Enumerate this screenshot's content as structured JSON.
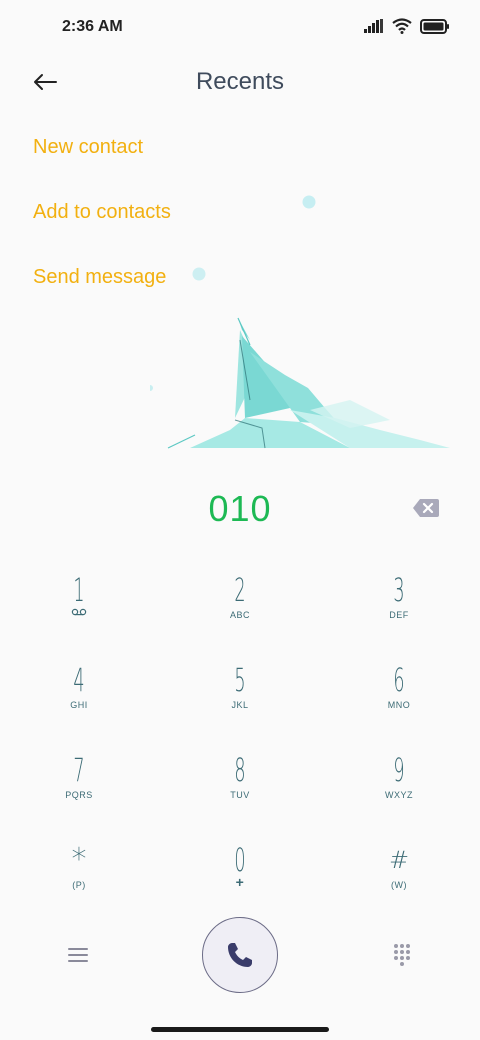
{
  "status_bar": {
    "time": "2:36 AM"
  },
  "header": {
    "title": "Recents"
  },
  "actions": {
    "new_contact": "New contact",
    "add_to_contacts": "Add to contacts",
    "send_message": "Send message"
  },
  "dialer": {
    "number": "010",
    "keys": [
      {
        "digit": "1",
        "letters": ""
      },
      {
        "digit": "2",
        "letters": "ABC"
      },
      {
        "digit": "3",
        "letters": "DEF"
      },
      {
        "digit": "4",
        "letters": "GHI"
      },
      {
        "digit": "5",
        "letters": "JKL"
      },
      {
        "digit": "6",
        "letters": "MNO"
      },
      {
        "digit": "7",
        "letters": "PQRS"
      },
      {
        "digit": "8",
        "letters": "TUV"
      },
      {
        "digit": "9",
        "letters": "WXYZ"
      },
      {
        "digit": "*",
        "letters": "(P)"
      },
      {
        "digit": "0",
        "letters": "+"
      },
      {
        "digit": "#",
        "letters": "(W)"
      }
    ]
  },
  "colors": {
    "accent": "#f2b010",
    "number": "#1db954",
    "keypad": "#3c6b75"
  }
}
